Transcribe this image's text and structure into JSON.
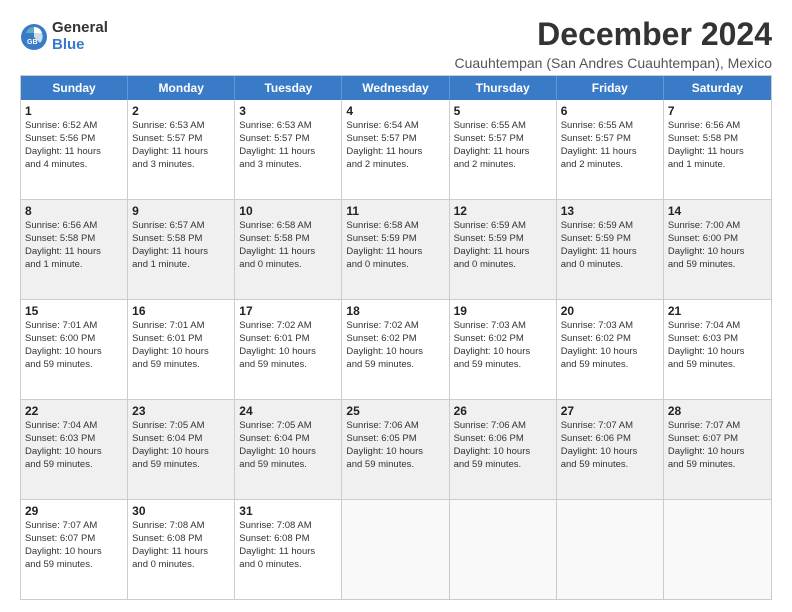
{
  "logo": {
    "general": "General",
    "blue": "Blue"
  },
  "header": {
    "month_title": "December 2024",
    "subtitle": "Cuauhtempan (San Andres Cuauhtempan), Mexico"
  },
  "days_of_week": [
    "Sunday",
    "Monday",
    "Tuesday",
    "Wednesday",
    "Thursday",
    "Friday",
    "Saturday"
  ],
  "weeks": [
    [
      {
        "day": "1",
        "lines": [
          "Sunrise: 6:52 AM",
          "Sunset: 5:56 PM",
          "Daylight: 11 hours",
          "and 4 minutes."
        ]
      },
      {
        "day": "2",
        "lines": [
          "Sunrise: 6:53 AM",
          "Sunset: 5:57 PM",
          "Daylight: 11 hours",
          "and 3 minutes."
        ]
      },
      {
        "day": "3",
        "lines": [
          "Sunrise: 6:53 AM",
          "Sunset: 5:57 PM",
          "Daylight: 11 hours",
          "and 3 minutes."
        ]
      },
      {
        "day": "4",
        "lines": [
          "Sunrise: 6:54 AM",
          "Sunset: 5:57 PM",
          "Daylight: 11 hours",
          "and 2 minutes."
        ]
      },
      {
        "day": "5",
        "lines": [
          "Sunrise: 6:55 AM",
          "Sunset: 5:57 PM",
          "Daylight: 11 hours",
          "and 2 minutes."
        ]
      },
      {
        "day": "6",
        "lines": [
          "Sunrise: 6:55 AM",
          "Sunset: 5:57 PM",
          "Daylight: 11 hours",
          "and 2 minutes."
        ]
      },
      {
        "day": "7",
        "lines": [
          "Sunrise: 6:56 AM",
          "Sunset: 5:58 PM",
          "Daylight: 11 hours",
          "and 1 minute."
        ]
      }
    ],
    [
      {
        "day": "8",
        "lines": [
          "Sunrise: 6:56 AM",
          "Sunset: 5:58 PM",
          "Daylight: 11 hours",
          "and 1 minute."
        ]
      },
      {
        "day": "9",
        "lines": [
          "Sunrise: 6:57 AM",
          "Sunset: 5:58 PM",
          "Daylight: 11 hours",
          "and 1 minute."
        ]
      },
      {
        "day": "10",
        "lines": [
          "Sunrise: 6:58 AM",
          "Sunset: 5:58 PM",
          "Daylight: 11 hours",
          "and 0 minutes."
        ]
      },
      {
        "day": "11",
        "lines": [
          "Sunrise: 6:58 AM",
          "Sunset: 5:59 PM",
          "Daylight: 11 hours",
          "and 0 minutes."
        ]
      },
      {
        "day": "12",
        "lines": [
          "Sunrise: 6:59 AM",
          "Sunset: 5:59 PM",
          "Daylight: 11 hours",
          "and 0 minutes."
        ]
      },
      {
        "day": "13",
        "lines": [
          "Sunrise: 6:59 AM",
          "Sunset: 5:59 PM",
          "Daylight: 11 hours",
          "and 0 minutes."
        ]
      },
      {
        "day": "14",
        "lines": [
          "Sunrise: 7:00 AM",
          "Sunset: 6:00 PM",
          "Daylight: 10 hours",
          "and 59 minutes."
        ]
      }
    ],
    [
      {
        "day": "15",
        "lines": [
          "Sunrise: 7:01 AM",
          "Sunset: 6:00 PM",
          "Daylight: 10 hours",
          "and 59 minutes."
        ]
      },
      {
        "day": "16",
        "lines": [
          "Sunrise: 7:01 AM",
          "Sunset: 6:01 PM",
          "Daylight: 10 hours",
          "and 59 minutes."
        ]
      },
      {
        "day": "17",
        "lines": [
          "Sunrise: 7:02 AM",
          "Sunset: 6:01 PM",
          "Daylight: 10 hours",
          "and 59 minutes."
        ]
      },
      {
        "day": "18",
        "lines": [
          "Sunrise: 7:02 AM",
          "Sunset: 6:02 PM",
          "Daylight: 10 hours",
          "and 59 minutes."
        ]
      },
      {
        "day": "19",
        "lines": [
          "Sunrise: 7:03 AM",
          "Sunset: 6:02 PM",
          "Daylight: 10 hours",
          "and 59 minutes."
        ]
      },
      {
        "day": "20",
        "lines": [
          "Sunrise: 7:03 AM",
          "Sunset: 6:02 PM",
          "Daylight: 10 hours",
          "and 59 minutes."
        ]
      },
      {
        "day": "21",
        "lines": [
          "Sunrise: 7:04 AM",
          "Sunset: 6:03 PM",
          "Daylight: 10 hours",
          "and 59 minutes."
        ]
      }
    ],
    [
      {
        "day": "22",
        "lines": [
          "Sunrise: 7:04 AM",
          "Sunset: 6:03 PM",
          "Daylight: 10 hours",
          "and 59 minutes."
        ]
      },
      {
        "day": "23",
        "lines": [
          "Sunrise: 7:05 AM",
          "Sunset: 6:04 PM",
          "Daylight: 10 hours",
          "and 59 minutes."
        ]
      },
      {
        "day": "24",
        "lines": [
          "Sunrise: 7:05 AM",
          "Sunset: 6:04 PM",
          "Daylight: 10 hours",
          "and 59 minutes."
        ]
      },
      {
        "day": "25",
        "lines": [
          "Sunrise: 7:06 AM",
          "Sunset: 6:05 PM",
          "Daylight: 10 hours",
          "and 59 minutes."
        ]
      },
      {
        "day": "26",
        "lines": [
          "Sunrise: 7:06 AM",
          "Sunset: 6:06 PM",
          "Daylight: 10 hours",
          "and 59 minutes."
        ]
      },
      {
        "day": "27",
        "lines": [
          "Sunrise: 7:07 AM",
          "Sunset: 6:06 PM",
          "Daylight: 10 hours",
          "and 59 minutes."
        ]
      },
      {
        "day": "28",
        "lines": [
          "Sunrise: 7:07 AM",
          "Sunset: 6:07 PM",
          "Daylight: 10 hours",
          "and 59 minutes."
        ]
      }
    ],
    [
      {
        "day": "29",
        "lines": [
          "Sunrise: 7:07 AM",
          "Sunset: 6:07 PM",
          "Daylight: 10 hours",
          "and 59 minutes."
        ]
      },
      {
        "day": "30",
        "lines": [
          "Sunrise: 7:08 AM",
          "Sunset: 6:08 PM",
          "Daylight: 11 hours",
          "and 0 minutes."
        ]
      },
      {
        "day": "31",
        "lines": [
          "Sunrise: 7:08 AM",
          "Sunset: 6:08 PM",
          "Daylight: 11 hours",
          "and 0 minutes."
        ]
      },
      {
        "day": "",
        "lines": []
      },
      {
        "day": "",
        "lines": []
      },
      {
        "day": "",
        "lines": []
      },
      {
        "day": "",
        "lines": []
      }
    ]
  ]
}
